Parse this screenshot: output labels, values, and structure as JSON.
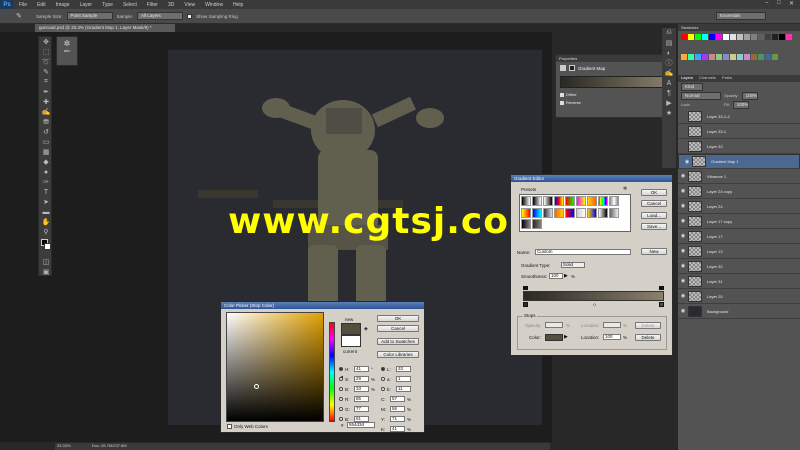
{
  "menubar": {
    "logo": "Ps",
    "items": [
      "File",
      "Edit",
      "Image",
      "Layer",
      "Type",
      "Select",
      "Filter",
      "3D",
      "View",
      "Window",
      "Help"
    ]
  },
  "options": {
    "sample_size_label": "Sample Size:",
    "sample_size": "Point Sample",
    "sample_label": "Sample:",
    "sample": "All Layers",
    "show_ring": "Show Sampling Ring",
    "workspace": "Essentials"
  },
  "document": {
    "tab": "gunroad.psd @ 33.3% (Gradient Map 1, Layer Mask/8) *",
    "zoom": "33.33%",
    "doc_size": "Doc: 26.7M/237.8M"
  },
  "side_panel": {
    "label": "abc"
  },
  "properties": {
    "title": "Properties",
    "panel_name": "Gradient Map",
    "dither": "Dither",
    "reverse": "Reverse"
  },
  "swatches": {
    "title": "Swatches"
  },
  "layers": {
    "tabs": [
      "Layers",
      "Channels",
      "Paths"
    ],
    "kind": "Kind",
    "blend": "Normal",
    "opacity_label": "Opacity:",
    "opacity": "100%",
    "lock_label": "Lock:",
    "fill_label": "Fill:",
    "fill": "100%",
    "items": [
      {
        "name": "Layer 33-1-2",
        "visible": false
      },
      {
        "name": "Layer 33-1",
        "visible": false
      },
      {
        "name": "Layer 33",
        "visible": false
      },
      {
        "name": "Gradient Map 1",
        "visible": true,
        "selected": true
      },
      {
        "name": "Vibrance 1",
        "visible": true
      },
      {
        "name": "Layer 24 copy",
        "visible": true
      },
      {
        "name": "Layer 24",
        "visible": true
      },
      {
        "name": "Layer 17 copy",
        "visible": true
      },
      {
        "name": "Layer 17",
        "visible": true
      },
      {
        "name": "Layer 13",
        "visible": true
      },
      {
        "name": "Layer 32",
        "visible": true
      },
      {
        "name": "Layer 31",
        "visible": true
      },
      {
        "name": "Layer 25",
        "visible": true
      },
      {
        "name": "Background",
        "visible": true
      }
    ]
  },
  "gradient_editor": {
    "title": "Gradient Editor",
    "presets": "Presets",
    "ok": "OK",
    "cancel": "Cancel",
    "load": "Load...",
    "save": "Save...",
    "name_label": "Name:",
    "name": "Custom",
    "new": "New",
    "type_label": "Gradient Type:",
    "type": "Solid",
    "smooth_label": "Smoothness:",
    "smooth": "100",
    "pct": "%",
    "stops_label": "Stops",
    "opacity_label": "Opacity:",
    "location_label": "Location:",
    "color_label": "Color:",
    "location": "100",
    "delete": "Delete"
  },
  "color_picker": {
    "title": "Color Picker (Stop Color)",
    "ok": "OK",
    "cancel": "Cancel",
    "add_swatches": "Add to Swatches",
    "color_libraries": "Color Libraries",
    "new_label": "new",
    "current_label": "current",
    "only_web": "Only Web Colors",
    "fields": [
      {
        "k": "H:",
        "v": "41",
        "u": "°"
      },
      {
        "k": "S:",
        "v": "29",
        "u": "%"
      },
      {
        "k": "B:",
        "v": "33",
        "u": "%"
      },
      {
        "k": "R:",
        "v": "85",
        "u": ""
      },
      {
        "k": "G:",
        "v": "77",
        "u": ""
      },
      {
        "k": "B:",
        "v": "61",
        "u": ""
      }
    ],
    "lab": [
      {
        "k": "L:",
        "v": "33"
      },
      {
        "k": "a:",
        "v": "1"
      },
      {
        "k": "b:",
        "v": "11"
      }
    ],
    "cmyk": [
      {
        "k": "C:",
        "v": "57",
        "u": "%"
      },
      {
        "k": "M:",
        "v": "56",
        "u": "%"
      },
      {
        "k": "Y:",
        "v": "71",
        "u": "%"
      },
      {
        "k": "K:",
        "v": "41",
        "u": "%"
      }
    ],
    "hex_label": "#",
    "hex": "554d3d",
    "new_color": "#554d3d",
    "current_color": "#ffffff"
  },
  "watermark": "www.cgtsj.com",
  "colors": {
    "accent": "#4c6890",
    "gradient_dark": "#2a2823",
    "gradient_light": "#8a806c"
  }
}
